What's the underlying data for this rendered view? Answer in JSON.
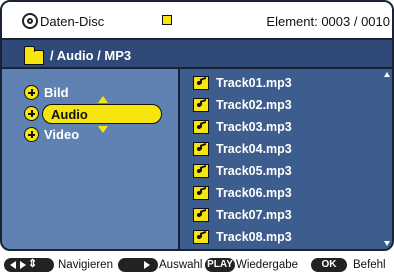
{
  "header": {
    "disc_label": "Daten-Disc",
    "element_label": "Element: 0003 / 0010"
  },
  "path": {
    "label": "/ Audio / MP3"
  },
  "categories": [
    {
      "label": "Bild"
    },
    {
      "label": "Audio",
      "selected": true
    },
    {
      "label": "Video"
    }
  ],
  "tracks": [
    {
      "label": "Track01.mp3"
    },
    {
      "label": "Track02.mp3"
    },
    {
      "label": "Track03.mp3"
    },
    {
      "label": "Track04.mp3"
    },
    {
      "label": "Track05.mp3"
    },
    {
      "label": "Track06.mp3"
    },
    {
      "label": "Track07.mp3"
    },
    {
      "label": "Track08.mp3"
    }
  ],
  "footer": {
    "navigate": "Navigieren",
    "select": "Auswahl",
    "play_key": "PLAY",
    "play": "Wiedergabe",
    "ok_key": "OK",
    "command": "Befehl"
  },
  "colors": {
    "background": "#5f82b3",
    "path_bar": "#2f4a78",
    "list_panel": "#3e5d8f",
    "accent_yellow": "#f6e60d"
  }
}
